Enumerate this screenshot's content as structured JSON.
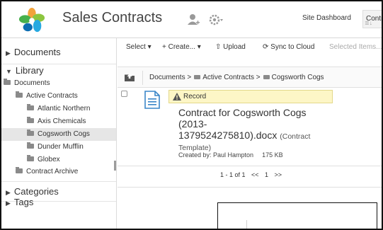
{
  "header": {
    "title": "Sales Contracts",
    "site_dashboard_label": "Site Dashboard",
    "contr_label": "Contr"
  },
  "sidebar": {
    "documents_heading": "Documents",
    "library_heading": "Library",
    "tree": [
      {
        "label": "Documents",
        "level": 0
      },
      {
        "label": "Active Contracts",
        "level": 1
      },
      {
        "label": "Atlantic Northern",
        "level": 2
      },
      {
        "label": "Axis Chemicals",
        "level": 2
      },
      {
        "label": "Cogsworth Cogs",
        "level": 2,
        "selected": true
      },
      {
        "label": "Dunder Mufflin",
        "level": 2
      },
      {
        "label": "Globex",
        "level": 2
      },
      {
        "label": "Contract Archive",
        "level": 1
      }
    ],
    "categories_heading": "Categories",
    "tags_heading": "Tags"
  },
  "toolbar": {
    "select_label": "Select ▾",
    "create_label": "+ Create... ▾",
    "upload_label": "Upload",
    "sync_label": "Sync to Cloud",
    "selected_items_label": "Selected Items..."
  },
  "breadcrumb": {
    "root": "Documents",
    "sep": ">",
    "level1": "Active Contracts",
    "level2": "Cogsworth Cogs"
  },
  "document": {
    "record_label": "Record",
    "title_line1": "Contract for Cogsworth Cogs",
    "title_line2": "(2013-",
    "title_line3": "1379524275810).docx",
    "template_note_a": "(Contract",
    "template_note_b": "Template)",
    "created_by": "Created by: Paul Hampton",
    "size": "175 KB"
  },
  "pager": {
    "range": "1 - 1 of 1",
    "prev": "<<",
    "page": "1",
    "next": ">>"
  },
  "colors": {
    "record_badge_bg": "#fdf6c6",
    "selected_row": "#e6e6e6",
    "doc_icon": "#3a86c8"
  }
}
